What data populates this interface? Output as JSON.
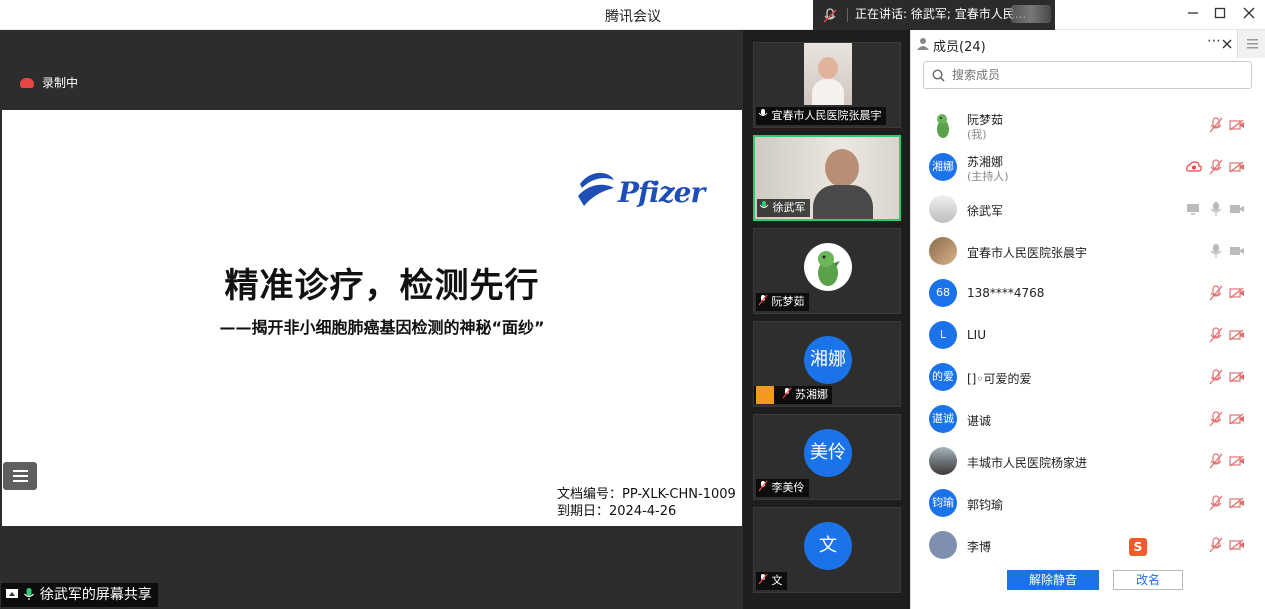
{
  "window": {
    "title": "腾讯会议",
    "speaking": "正在讲话: 徐武军; 宜春市人民..."
  },
  "share": {
    "recording": "录制中",
    "slide": {
      "logo": "Pfizer",
      "title": "精准诊疗，检测先行",
      "subtitle": "——揭开非小细胞肺癌基因检测的神秘“面纱”",
      "doc_no": "文档编号：PP-XLK-CHN-1009",
      "expiry": "到期日：2024-4-26"
    },
    "sharer_label": "徐武军的屏幕共享"
  },
  "tiles": [
    {
      "name": "宜春市人民医院张晨宇",
      "type": "video",
      "mic": "on"
    },
    {
      "name": "徐武军",
      "type": "video",
      "mic": "speaking"
    },
    {
      "name": "阮梦茹",
      "type": "avatar",
      "mic": "muted"
    },
    {
      "name": "苏湘娜",
      "type": "initials",
      "initials": "湘娜",
      "mic": "muted"
    },
    {
      "name": "李美伶",
      "type": "initials",
      "initials": "美伶",
      "mic": "muted"
    },
    {
      "name": "文",
      "type": "initials",
      "initials": "文",
      "mic": "muted"
    }
  ],
  "panel": {
    "title": "成员(24)",
    "search_placeholder": "搜索成员",
    "members": [
      {
        "name": "阮梦茹",
        "role": "(我)",
        "avatar": "dino",
        "mic": "muted",
        "cam": "off"
      },
      {
        "name": "苏湘娜",
        "role": "(主持人)",
        "avatar": "initials",
        "initials": "湘娜",
        "mic": "muted",
        "cam": "off",
        "recording": true
      },
      {
        "name": "徐武军",
        "role": "",
        "avatar": "photo",
        "mic": "on",
        "cam": "on",
        "sharing": true
      },
      {
        "name": "宜春市人民医院张晨宇",
        "role": "",
        "avatar": "photo",
        "mic": "on",
        "cam": "on"
      },
      {
        "name": "138****4768",
        "role": "",
        "avatar": "initials",
        "initials": "68",
        "mic": "muted",
        "cam": "off"
      },
      {
        "name": "LIU",
        "role": "",
        "avatar": "initials",
        "initials": "L",
        "mic": "muted",
        "cam": "off"
      },
      {
        "name": "[]◦可爱的爱",
        "role": "",
        "avatar": "initials",
        "initials": "的爱",
        "mic": "muted",
        "cam": "off"
      },
      {
        "name": "谌诚",
        "role": "",
        "avatar": "initials",
        "initials": "谌诚",
        "mic": "muted",
        "cam": "off"
      },
      {
        "name": "丰城市人民医院杨家进",
        "role": "",
        "avatar": "photo",
        "mic": "muted",
        "cam": "off"
      },
      {
        "name": "郭钧瑜",
        "role": "",
        "avatar": "initials",
        "initials": "钧瑜",
        "mic": "muted",
        "cam": "off"
      },
      {
        "name": "李博",
        "role": "",
        "avatar": "photo",
        "mic": "muted",
        "cam": "off"
      }
    ],
    "unmute_all": "解除静音",
    "rename": "改名"
  },
  "colors": {
    "accent": "#1a73e8",
    "active_border": "#2ecc71",
    "muted_red": "#e84545"
  }
}
